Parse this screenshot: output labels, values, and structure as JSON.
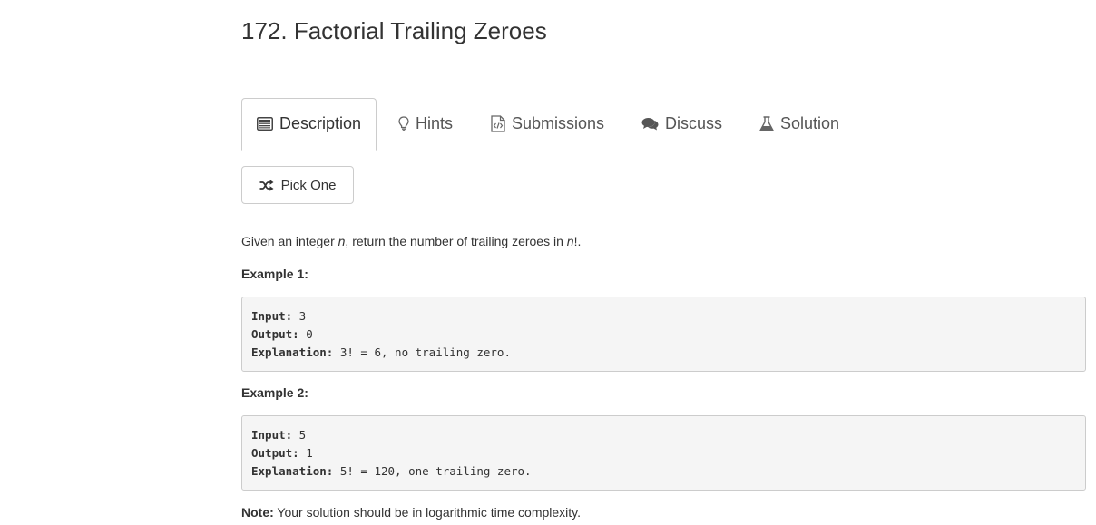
{
  "problem": {
    "title": "172. Factorial Trailing Zeroes"
  },
  "tabs": [
    {
      "label": "Description",
      "icon": "list-icon",
      "active": true
    },
    {
      "label": "Hints",
      "icon": "lightbulb-icon",
      "active": false
    },
    {
      "label": "Submissions",
      "icon": "code-file-icon",
      "active": false
    },
    {
      "label": "Discuss",
      "icon": "comments-icon",
      "active": false
    },
    {
      "label": "Solution",
      "icon": "flask-icon",
      "active": false
    }
  ],
  "pick_one": {
    "label": "Pick One",
    "icon": "shuffle-icon"
  },
  "description": {
    "prefix": "Given an integer ",
    "var_n": "n",
    "middle": ", return the number of trailing zeroes in ",
    "var_nfact": "n",
    "fact": "!",
    "suffix": "."
  },
  "examples": [
    {
      "label": "Example 1:",
      "input_key": "Input:",
      "input_val": " 3",
      "output_key": "Output:",
      "output_val": " 0",
      "explanation_key": "Explanation:",
      "explanation_val": " 3! = 6, no trailing zero."
    },
    {
      "label": "Example 2:",
      "input_key": "Input:",
      "input_val": " 5",
      "output_key": "Output:",
      "output_val": " 1",
      "explanation_key": "Explanation:",
      "explanation_val": " 5! = 120, one trailing zero."
    }
  ],
  "note": {
    "key": "Note:",
    "text": " Your solution should be in logarithmic time complexity."
  }
}
